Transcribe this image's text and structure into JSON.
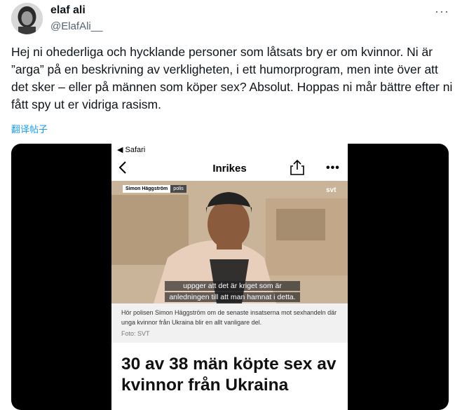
{
  "tweet": {
    "author_name": "elaf ali",
    "author_handle": "@ElafAli__",
    "more_label": "···",
    "text": "Hej ni ohederliga och hycklande personer som låtsats bry er om kvinnor. Ni är ”arga” på en beskrivning av verkligheten, i ett humorprogram, men inte över att det sker – eller på männen som köper sex? Absolut. Hoppas ni mår bättre efter ni fått spy ut er vidriga rasism.",
    "translate_label": "翻译帖子"
  },
  "phone": {
    "status_text": "◀ Safari",
    "nav_title": "Inrikes",
    "more_label": "•••",
    "video": {
      "lower_third_name": "Simon Häggström",
      "lower_third_role": "polis",
      "watermark": "svt",
      "subtitle_line1": "uppger att det är kriget som är",
      "subtitle_line2": "anledningen till att man hamnat i detta."
    },
    "caption": "Hör polisen Simon Häggström om de senaste insatserna mot sexhandeln där unga kvinnor från Ukraina blir en allt vanligare del.",
    "photo_credit": "Foto: SVT",
    "headline": "30 av 38 män köpte sex av kvinnor från Ukraina"
  },
  "icons": [
    "avatar",
    "more-icon",
    "back-chevron-icon",
    "share-icon",
    "more-icon"
  ],
  "colors": {
    "link": "#1d9bf0",
    "handle": "#536471",
    "text": "#0f1419"
  }
}
